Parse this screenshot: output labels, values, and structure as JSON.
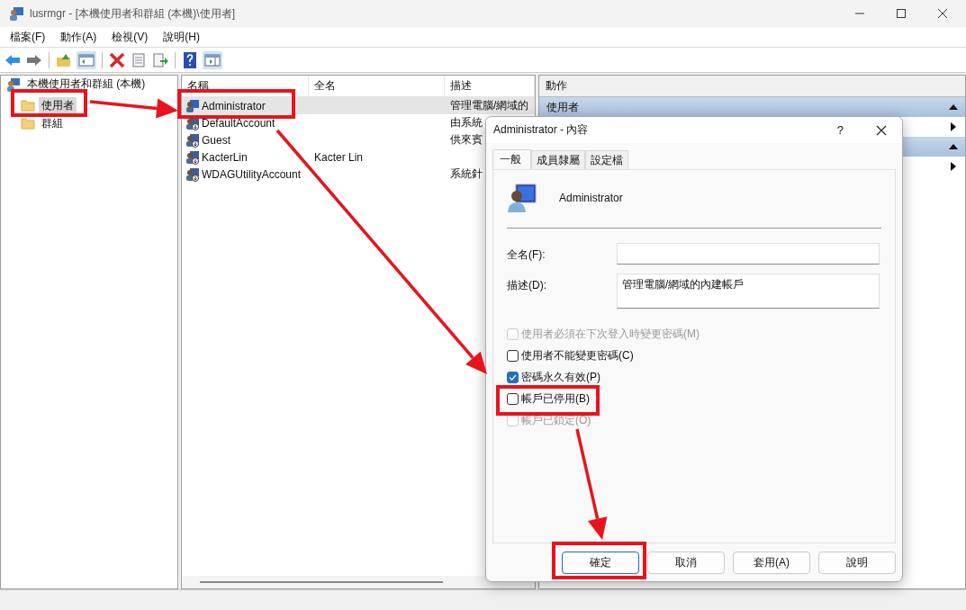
{
  "window": {
    "title": "lusrmgr - [本機使用者和群組 (本機)\\使用者]"
  },
  "menu": [
    "檔案(F)",
    "動作(A)",
    "檢視(V)",
    "說明(H)"
  ],
  "tree": {
    "label": "本機使用者和群組 (本機)",
    "children": [
      {
        "label": "使用者",
        "selected": true
      },
      {
        "label": "群組",
        "selected": false
      }
    ]
  },
  "list": {
    "columns": [
      "名稱",
      "全名",
      "描述"
    ],
    "rows": [
      {
        "name": "Administrator",
        "description": "管理電腦/網域的",
        "selected": true
      },
      {
        "name": "DefaultAccount",
        "description": "由系統",
        "selected": false
      },
      {
        "name": "Guest",
        "description": "供來賓",
        "selected": false
      },
      {
        "name": "KacterLin",
        "full_name": "Kacter Lin",
        "selected": false
      },
      {
        "name": "WDAGUtilityAccount",
        "description": "系統針",
        "selected": false
      }
    ]
  },
  "actions": {
    "title": "動作",
    "group": "使用者"
  },
  "dialog": {
    "title": "Administrator - 內容",
    "help": "?",
    "tabs": [
      {
        "label": "一般",
        "selected": true
      },
      {
        "label": "成員隸屬",
        "selected": false
      },
      {
        "label": "設定檔",
        "selected": false
      }
    ],
    "user": "Administrator",
    "fields": [
      {
        "label": "全名(F):"
      },
      {
        "label": "描述(D):",
        "value": "管理電腦/網域的內建帳戶"
      }
    ],
    "checkboxes": [
      {
        "label": "使用者必須在下次登入時變更密碼(M)",
        "checked": false,
        "disabled": true
      },
      {
        "label": "使用者不能變更密碼(C)",
        "checked": false,
        "disabled": false
      },
      {
        "label": "密碼永久有效(P)",
        "checked": true,
        "disabled": false
      },
      {
        "label": "帳戶已停用(B)",
        "checked": false,
        "disabled": false
      },
      {
        "label": "帳戶已鎖定(O)",
        "checked": false,
        "disabled": true
      }
    ],
    "buttons": [
      {
        "label": "確定",
        "default": true
      },
      {
        "label": "取消",
        "default": false
      },
      {
        "label": "套用(A)",
        "default": false
      },
      {
        "label": "說明",
        "default": false
      }
    ]
  }
}
